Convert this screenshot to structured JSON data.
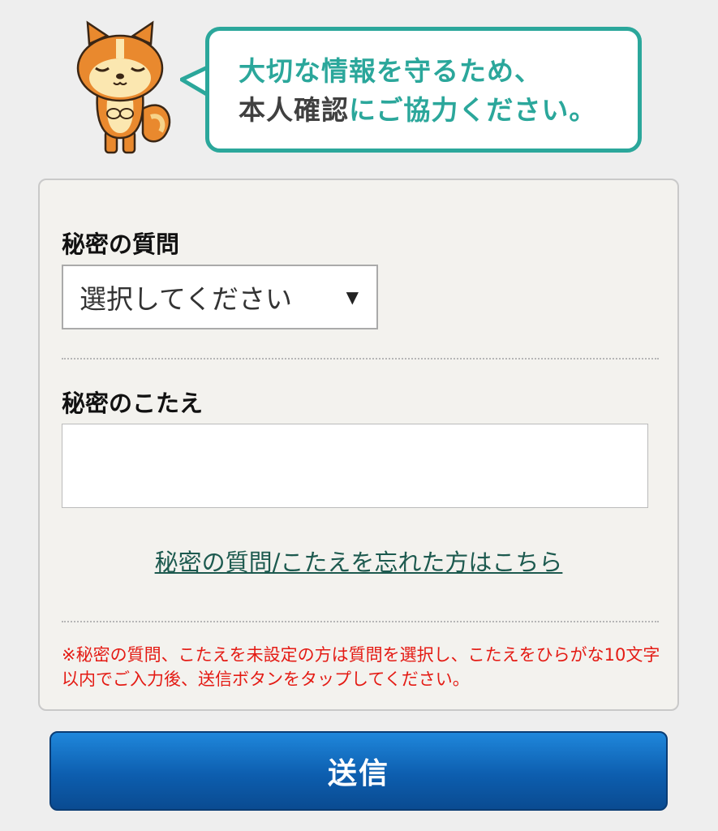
{
  "header": {
    "bubble_line1": "大切な情報を守るため、",
    "bubble_line2_emphasis": "本人確認",
    "bubble_line2_rest": "にご協力ください。"
  },
  "form": {
    "question_label": "秘密の質問",
    "question_select_value": "選択してください",
    "answer_label": "秘密のこたえ",
    "answer_value": "",
    "forgot_link": "秘密の質問/こたえを忘れた方はこちら",
    "note": "※秘密の質問、こたえを未設定の方は質問を選択し、こたえをひらがな10文字以内でご入力後、送信ボタンをタップしてください。"
  },
  "submit_label": "送信",
  "colors": {
    "teal": "#2ba79b",
    "note_red": "#e41b14",
    "button_blue": "#0d5eaf",
    "link": "#1d5a4f"
  }
}
